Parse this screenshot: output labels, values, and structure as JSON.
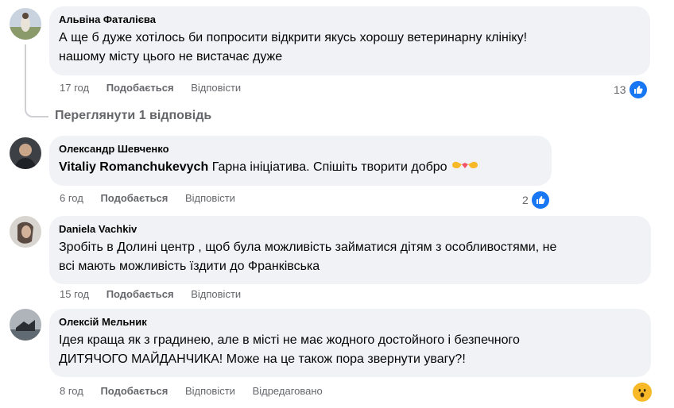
{
  "comments": [
    {
      "author": "Альвіна Фаталієва",
      "text_line1": "А ще б дуже хотілось би попросити відкрити якусь хорошу ветеринарну клініку!",
      "text_line2": "нашому місту цього не вистачає дуже",
      "time": "17 год",
      "like": "Подобається",
      "reply": "Відповісти",
      "reaction_count": "13",
      "reaction_icon": "like-icon"
    },
    {
      "author": "Олександр Шевченко",
      "mention": "Vitaliy Romanchukevych",
      "text_line1": "Гарна ініціатива. Спішіть творити добро",
      "time": "6 год",
      "like": "Подобається",
      "reply": "Відповісти",
      "reaction_count": "2",
      "reaction_icon": "like-icon"
    },
    {
      "author": "Daniela Vachkiv",
      "text_line1": "Зробіть в Долині центр , щоб була можливість займатися дітям з особливостями, не",
      "text_line2": "всі мають можливість їздити до Франківська",
      "time": "15 год",
      "like": "Подобається",
      "reply": "Відповісти"
    },
    {
      "author": "Олексій Мельник",
      "text_line1": "Ідея краща як з градинею, але в місті не має жодного достойного і безпечного",
      "text_line2": "ДИТЯЧОГО МАЙДАНЧИКА! Може на це також пора звернути увагу?!",
      "time": "8 год",
      "like": "Подобається",
      "reply": "Відповісти",
      "edited": "Відредаговано",
      "reaction_icon": "wow-icon"
    }
  ],
  "view_replies": "Переглянути 1 відповідь",
  "colors": {
    "bubble": "#f0f2f5",
    "meta": "#65676b",
    "like_blue": "#1877f2",
    "wow_yellow": "#f7b928"
  }
}
